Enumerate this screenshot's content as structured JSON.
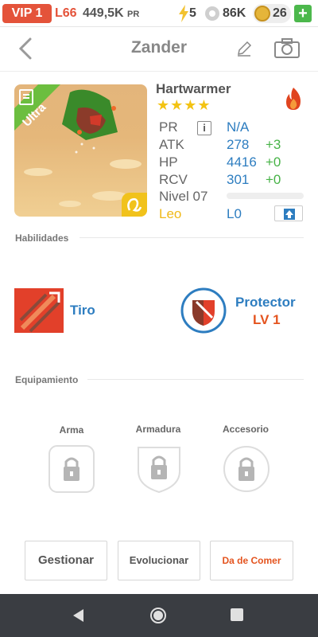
{
  "status": {
    "vip": "VIP 1",
    "level": "L66",
    "pr": "449,5K",
    "pr_unit": "PR",
    "energy": "5",
    "gems": "86K",
    "coins": "26",
    "plus": "+"
  },
  "header": {
    "title": "Zander"
  },
  "pet": {
    "name": "Hartwarmer",
    "rarity": "Ultra",
    "stars": "★★★★",
    "stats": [
      {
        "label": "PR",
        "value": "N/A",
        "bonus": ""
      },
      {
        "label": "ATK",
        "value": "278",
        "bonus": "+3"
      },
      {
        "label": "HP",
        "value": "4416",
        "bonus": "+0"
      },
      {
        "label": "RCV",
        "value": "301",
        "bonus": "+0"
      }
    ],
    "level_label": "Nivel 07",
    "sign_label": "Leo",
    "sign_level": "L0",
    "info_icon": "i",
    "xp_fraction": 0.0
  },
  "sections": {
    "skills": "Habilidades",
    "equipment": "Equipamiento"
  },
  "skills": {
    "left": {
      "name": "Tiro"
    },
    "right": {
      "name": "Protector",
      "level": "LV 1"
    }
  },
  "equipment": [
    {
      "label": "Arma"
    },
    {
      "label": "Armadura"
    },
    {
      "label": "Accesorio"
    }
  ],
  "actions": {
    "manage": "Gestionar",
    "evolve": "Evolucionar",
    "feed": "Da de Comer"
  },
  "colors": {
    "accent_red": "#e4533a",
    "blue": "#2d7dc0",
    "green": "#47b347",
    "gold": "#f0b919"
  }
}
